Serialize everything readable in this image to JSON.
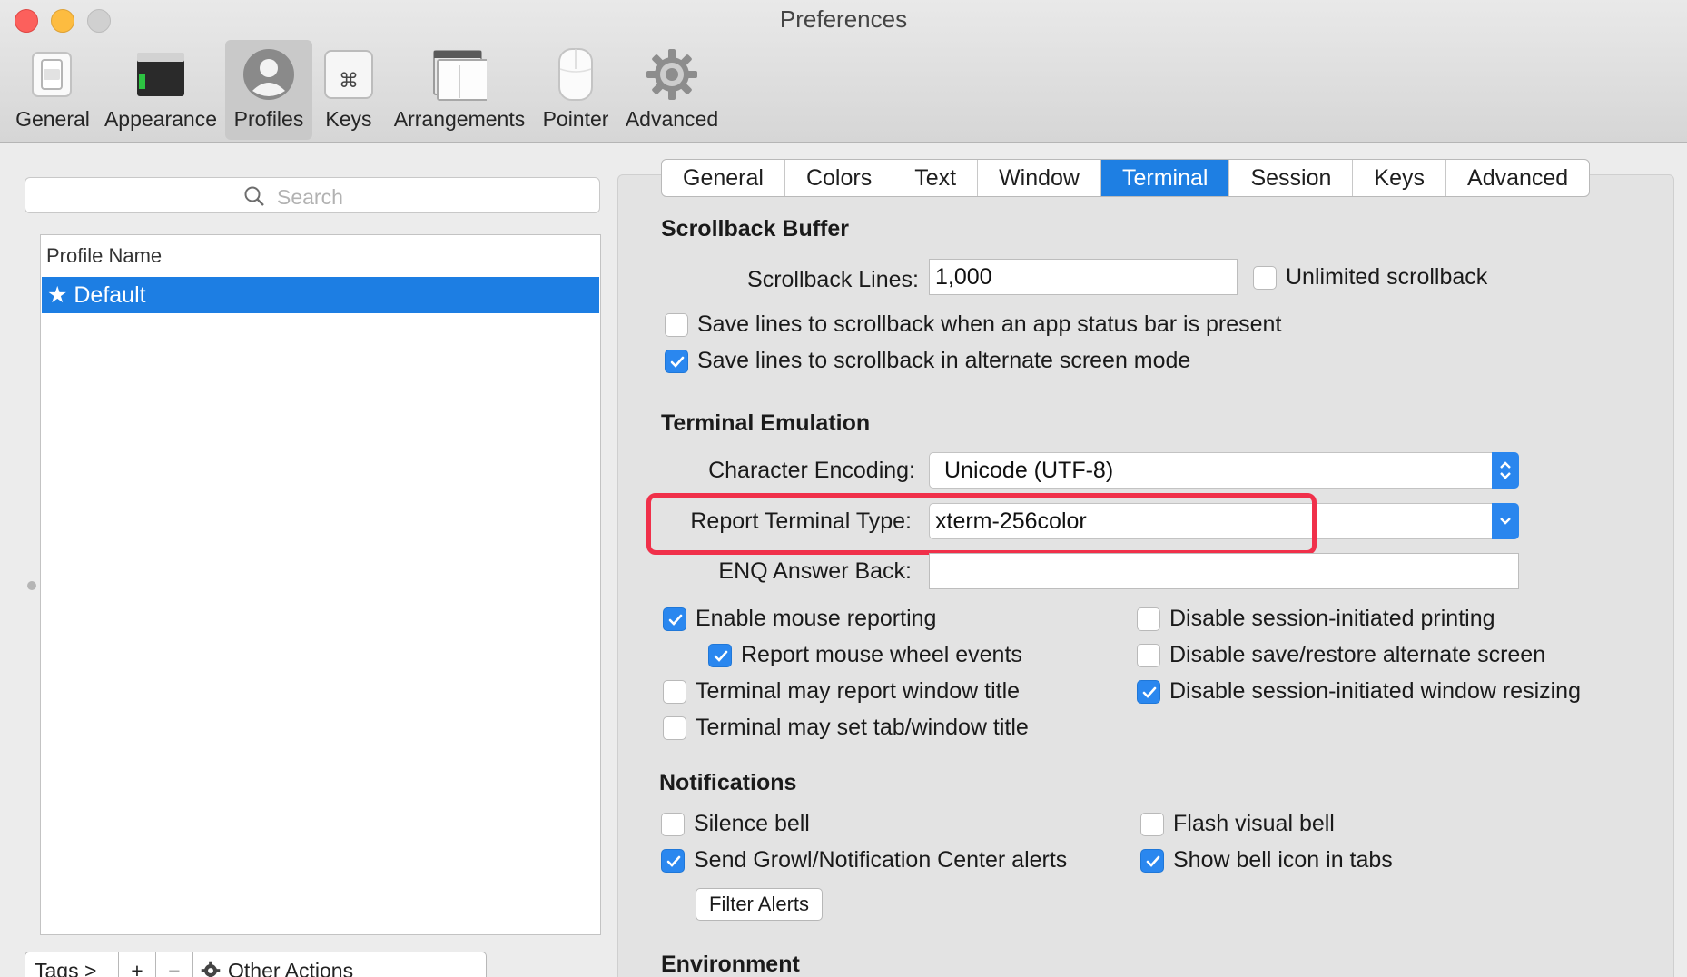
{
  "window": {
    "title": "Preferences"
  },
  "toolbar": {
    "items": [
      {
        "label": "General"
      },
      {
        "label": "Appearance"
      },
      {
        "label": "Profiles"
      },
      {
        "label": "Keys"
      },
      {
        "label": "Arrangements"
      },
      {
        "label": "Pointer"
      },
      {
        "label": "Advanced"
      }
    ],
    "selected": "Profiles"
  },
  "sidebar": {
    "search_placeholder": "Search",
    "column_header": "Profile Name",
    "profiles": [
      {
        "star": "★",
        "name": "Default"
      }
    ],
    "bottom": {
      "tags": "Tags >",
      "add": "+",
      "remove": "−",
      "other_actions": "Other Actions"
    }
  },
  "tabs": {
    "items": [
      "General",
      "Colors",
      "Text",
      "Window",
      "Terminal",
      "Session",
      "Keys",
      "Advanced"
    ],
    "active": "Terminal"
  },
  "scrollback": {
    "heading": "Scrollback Buffer",
    "lines_label": "Scrollback Lines:",
    "lines_value": "1,000",
    "unlimited": {
      "label": "Unlimited scrollback",
      "checked": false
    },
    "save_status_bar": {
      "label": "Save lines to scrollback when an app status bar is present",
      "checked": false
    },
    "save_alternate": {
      "label": "Save lines to scrollback in alternate screen mode",
      "checked": true
    }
  },
  "emulation": {
    "heading": "Terminal Emulation",
    "encoding_label": "Character Encoding:",
    "encoding_value": "Unicode (UTF-8)",
    "report_label": "Report Terminal Type:",
    "report_value": "xterm-256color",
    "enq_label": "ENQ Answer Back:",
    "enq_value": "",
    "options_left": [
      {
        "label": "Enable mouse reporting",
        "checked": true
      },
      {
        "label": "Report mouse wheel events",
        "checked": true
      },
      {
        "label": "Terminal may report window title",
        "checked": false
      },
      {
        "label": "Terminal may set tab/window title",
        "checked": false
      }
    ],
    "options_right": [
      {
        "label": "Disable session-initiated printing",
        "checked": false
      },
      {
        "label": "Disable save/restore alternate screen",
        "checked": false
      },
      {
        "label": "Disable session-initiated window resizing",
        "checked": true
      }
    ]
  },
  "notifications": {
    "heading": "Notifications",
    "silence_bell": {
      "label": "Silence bell",
      "checked": false
    },
    "flash_bell": {
      "label": "Flash visual bell",
      "checked": false
    },
    "send_growl": {
      "label": "Send Growl/Notification Center alerts",
      "checked": true
    },
    "bell_icon": {
      "label": "Show bell icon in tabs",
      "checked": true
    },
    "filter_button": "Filter Alerts"
  },
  "environment": {
    "heading": "Environment"
  },
  "colors": {
    "accent": "#1e7fe3",
    "highlight": "#f0304a"
  }
}
